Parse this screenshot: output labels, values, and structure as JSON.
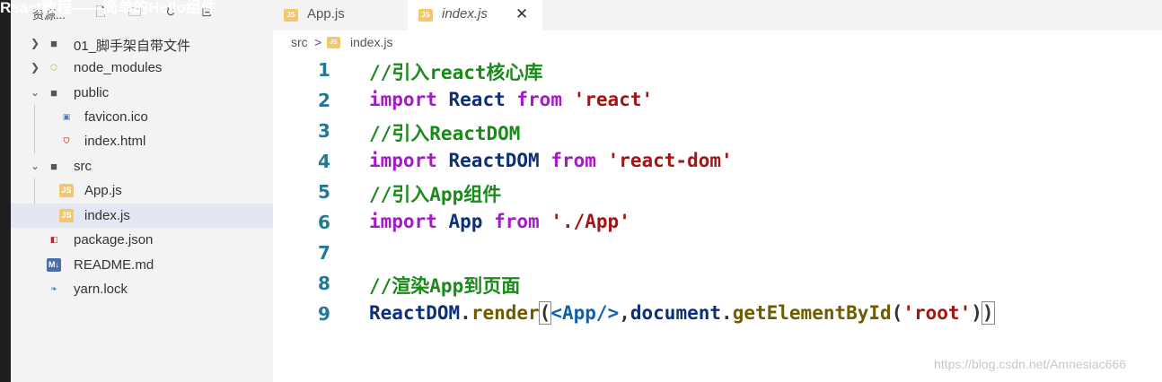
{
  "overlay_title": "React教程——简单的Hello组件",
  "sidebar": {
    "title": "资源...",
    "items": [
      {
        "label": "01_脚手架自带文件",
        "type": "folder",
        "expanded": false
      },
      {
        "label": "node_modules",
        "type": "folder",
        "expanded": false
      },
      {
        "label": "public",
        "type": "folder",
        "expanded": true
      },
      {
        "label": "favicon.ico",
        "type": "file"
      },
      {
        "label": "index.html",
        "type": "file"
      },
      {
        "label": "src",
        "type": "folder",
        "expanded": true
      },
      {
        "label": "App.js",
        "type": "file"
      },
      {
        "label": "index.js",
        "type": "file",
        "selected": true
      },
      {
        "label": "package.json",
        "type": "file"
      },
      {
        "label": "README.md",
        "type": "file"
      },
      {
        "label": "yarn.lock",
        "type": "file"
      }
    ]
  },
  "tabs": [
    {
      "label": "App.js",
      "icon": "JS",
      "active": false
    },
    {
      "label": "index.js",
      "icon": "JS",
      "active": true,
      "close": "✕"
    }
  ],
  "breadcrumb": {
    "folder": "src",
    "sep": ">",
    "icon": "JS",
    "file": "index.js"
  },
  "code": {
    "line_numbers": [
      "1",
      "2",
      "3",
      "4",
      "5",
      "6",
      "7",
      "8",
      "9"
    ],
    "line1": "//引入react核心库",
    "line2": {
      "kw": "import",
      "id": "React",
      "from": "from",
      "str": "'react'"
    },
    "line3": "//引入ReactDOM",
    "line4": {
      "kw": "import",
      "id": "ReactDOM",
      "from": "from",
      "str": "'react-dom'"
    },
    "line5": "//引入App组件",
    "line6": {
      "kw": "import",
      "id": "App",
      "from": "from",
      "str": "'./App'"
    },
    "line8": "//渲染App到页面",
    "line9": {
      "obj": "ReactDOM",
      "dot1": ".",
      "method": "render",
      "open": "(",
      "tag_open": "<",
      "tag_name": "App",
      "tag_close": "/>",
      "comma": ",",
      "doc": "document",
      "dot2": ".",
      "getter": "getElementById",
      "open2": "(",
      "arg": "'root'",
      "close2": ")",
      "close": ")"
    }
  },
  "watermark": "https://blog.csdn.net/Amnesiac666",
  "colors": {
    "comment": "#1a8a1a",
    "keyword": "#a31ac6",
    "identifier": "#0c2f7a",
    "string": "#a31515",
    "js_icon": "#f1c86a"
  }
}
